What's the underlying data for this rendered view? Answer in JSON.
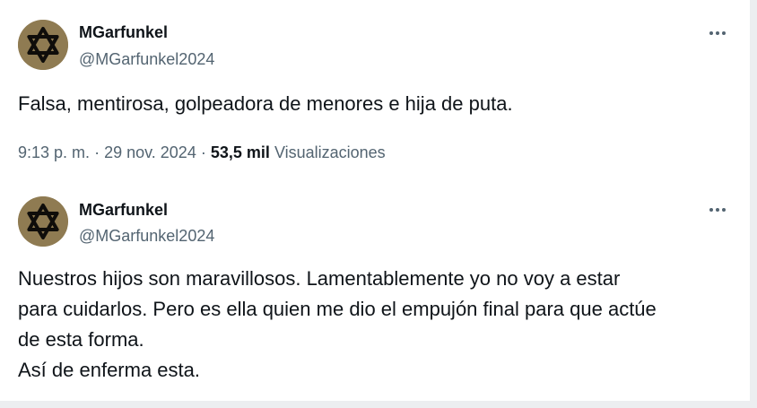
{
  "tweets": [
    {
      "author": {
        "name": "MGarfunkel",
        "handle": "@MGarfunkel2024",
        "avatar_icon": "star-of-david-icon"
      },
      "text_lines": [
        "Falsa, mentirosa, golpeadora de menores e hija de puta."
      ],
      "meta": {
        "time": "9:13 p. m.",
        "separator": "·",
        "date": "29 nov. 2024",
        "views_count": "53,5 mil",
        "views_label": "Visualizaciones"
      }
    },
    {
      "author": {
        "name": "MGarfunkel",
        "handle": "@MGarfunkel2024",
        "avatar_icon": "star-of-david-icon"
      },
      "text_lines": [
        "Nuestros hijos son maravillosos. Lamentablemente yo no voy a estar",
        "para cuidarlos. Pero es ella quien me dio el empujón final para que actúe",
        "de esta forma.",
        "Así de enferma esta."
      ]
    }
  ],
  "colors": {
    "text_primary": "#0f1419",
    "text_secondary": "#536471",
    "avatar_bg": "#8f7b52",
    "background": "#ffffff"
  },
  "icons": {
    "more": "more-options-icon",
    "avatar": "star-of-david-icon"
  }
}
